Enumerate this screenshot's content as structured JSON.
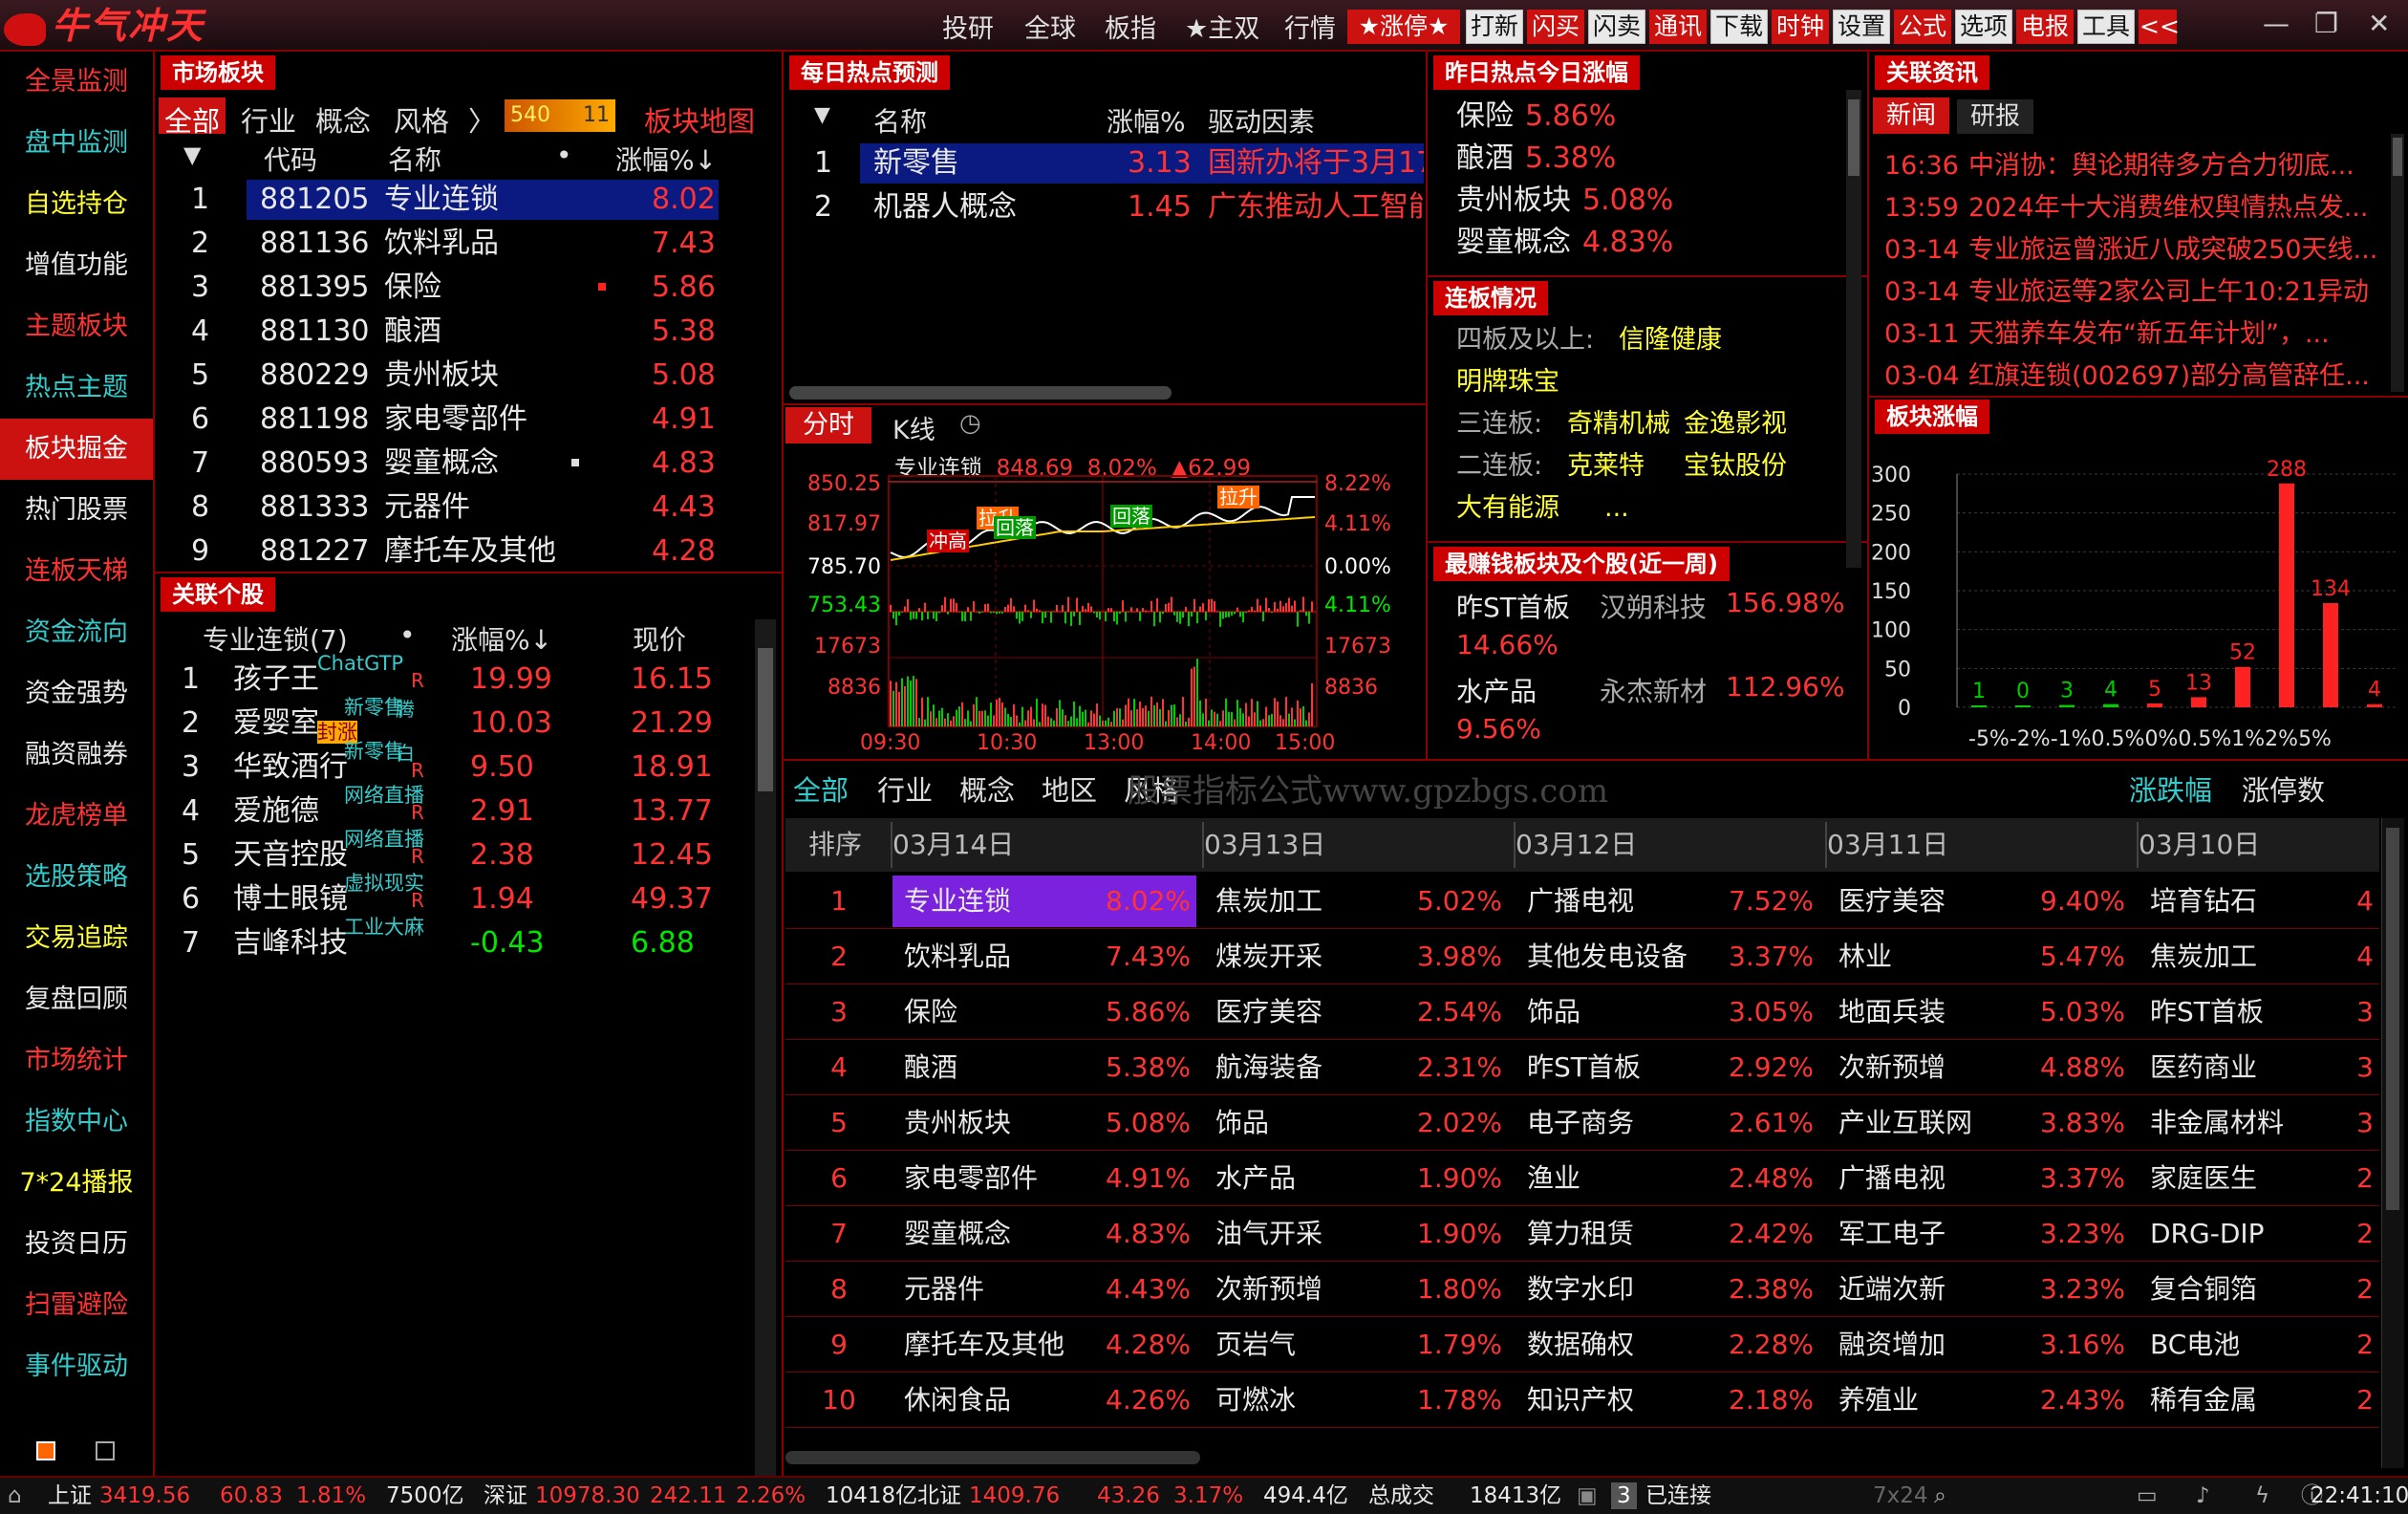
{
  "app": {
    "logo": "牛气冲天",
    "watermark": "股票指标公式www.gpzbgs.com"
  },
  "topnav": [
    "投研",
    "全球",
    "板指",
    "★主双",
    "行情"
  ],
  "topbuttons": [
    "★涨停★",
    "打新",
    "闪买",
    "闪卖",
    "通讯",
    "下载",
    "时钟",
    "设置",
    "公式",
    "选项",
    "电报",
    "工具",
    "<<"
  ],
  "sidebar": [
    "全景监测",
    "盘中监测",
    "自选持仓",
    "增值功能",
    "主题板块",
    "热点主题",
    "板块掘金",
    "热门股票",
    "连板天梯",
    "资金流向",
    "资金强势",
    "融资融券",
    "龙虎榜单",
    "选股策略",
    "交易追踪",
    "复盘回顾",
    "市场统计",
    "指数中心",
    "7*24播报",
    "投资日历",
    "扫雷避险",
    "事件驱动"
  ],
  "market_sector": {
    "title": "市场板块",
    "tabs": [
      "全部",
      "行业",
      "概念",
      "风格",
      "〉"
    ],
    "counter": "540",
    "counter2": "11",
    "map_link": "板块地图",
    "headers": [
      "代码",
      "名称",
      "•",
      "涨幅%↓"
    ],
    "rows": [
      {
        "n": "1",
        "code": "881205",
        "name": "专业连锁",
        "pct": "8.02"
      },
      {
        "n": "2",
        "code": "881136",
        "name": "饮料乳品",
        "pct": "7.43"
      },
      {
        "n": "3",
        "code": "881395",
        "name": "保险",
        "pct": "5.86"
      },
      {
        "n": "4",
        "code": "881130",
        "name": "酿酒",
        "pct": "5.38"
      },
      {
        "n": "5",
        "code": "880229",
        "name": "贵州板块",
        "pct": "5.08"
      },
      {
        "n": "6",
        "code": "881198",
        "name": "家电零部件",
        "pct": "4.91"
      },
      {
        "n": "7",
        "code": "880593",
        "name": "婴童概念",
        "pct": "4.83"
      },
      {
        "n": "8",
        "code": "881333",
        "name": "元器件",
        "pct": "4.43"
      },
      {
        "n": "9",
        "code": "881227",
        "name": "摩托车及其他",
        "pct": "4.28"
      }
    ]
  },
  "related_stocks": {
    "title": "关联个股",
    "headers": [
      "专业连锁(7)",
      "•",
      "涨幅%↓",
      "现价"
    ],
    "rows": [
      {
        "n": "1",
        "name": "孩子王",
        "tag": "ChatGTP",
        "flag": "R",
        "pct": "19.99",
        "price": "16.15"
      },
      {
        "n": "2",
        "name": "爱婴室",
        "tag": "新零售",
        "tag2": "封涨",
        "flag": "腾",
        "pct": "10.03",
        "price": "21.29"
      },
      {
        "n": "3",
        "name": "华致酒行",
        "tag": "新零售",
        "flag": "白",
        "flag2": "R",
        "pct": "9.50",
        "price": "18.91"
      },
      {
        "n": "4",
        "name": "爱施德",
        "tag": "网络直播",
        "flag": "R",
        "pct": "2.91",
        "price": "13.77"
      },
      {
        "n": "5",
        "name": "天音控股",
        "tag": "网络直播",
        "flag": "R",
        "pct": "2.38",
        "price": "12.45"
      },
      {
        "n": "6",
        "name": "博士眼镜",
        "tag": "虚拟现实",
        "flag": "R",
        "pct": "1.94",
        "price": "49.37"
      },
      {
        "n": "7",
        "name": "吉峰科技",
        "tag": "工业大麻",
        "flag": "",
        "pct": "-0.43",
        "price": "6.88"
      }
    ]
  },
  "daily_hot": {
    "title": "每日热点预测",
    "headers": [
      "名称",
      "涨幅%",
      "驱动因素"
    ],
    "rows": [
      {
        "n": "1",
        "name": "新零售",
        "pct": "3.13",
        "reason": "国新办将于3月17"
      },
      {
        "n": "2",
        "name": "机器人概念",
        "pct": "1.45",
        "reason": "广东推动人工智能"
      }
    ]
  },
  "yesterday_hot": {
    "title": "昨日热点今日涨幅",
    "rows": [
      {
        "name": "保险",
        "pct": "5.86%"
      },
      {
        "name": "酿酒",
        "pct": "5.38%"
      },
      {
        "name": "贵州板块",
        "pct": "5.08%"
      },
      {
        "name": "婴童概念",
        "pct": "4.83%"
      }
    ]
  },
  "limit_board": {
    "title": "连板情况",
    "rows": [
      {
        "label": "四板及以上:",
        "stocks": [
          "信隆健康"
        ]
      },
      {
        "label": "",
        "stocks": [
          "明牌珠宝"
        ]
      },
      {
        "label": "三连板:",
        "stocks": [
          "奇精机械",
          "金逸影视"
        ]
      },
      {
        "label": "二连板:",
        "stocks": [
          "克莱特",
          "宝钛股份"
        ]
      },
      {
        "label": "",
        "stocks": [
          "大有能源",
          "..."
        ]
      }
    ]
  },
  "most_profit": {
    "title": "最赚钱板块及个股(近一周)",
    "rows": [
      {
        "sector": "昨ST首板",
        "stock": "汉朔科技",
        "stock_pct": "156.98%",
        "sector_pct": "14.66%"
      },
      {
        "sector": "水产品",
        "stock": "永杰新材",
        "stock_pct": "112.96%",
        "sector_pct": "9.56%"
      }
    ]
  },
  "news": {
    "title": "关联资讯",
    "tabs": [
      "新闻",
      "研报"
    ],
    "rows": [
      {
        "time": "16:36",
        "text": "中消协：舆论期待多方合力彻底..."
      },
      {
        "time": "13:59",
        "text": "2024年十大消费维权舆情热点发..."
      },
      {
        "time": "03-14",
        "text": "专业旅运曾涨近八成突破250天线..."
      },
      {
        "time": "03-14",
        "text": "专业旅运等2家公司上午10:21异动"
      },
      {
        "time": "03-11",
        "text": "天猫养车发布“新五年计划”，..."
      },
      {
        "time": "03-04",
        "text": "红旗连锁(002697)部分高管辞任..."
      }
    ]
  },
  "intraday": {
    "tabs": [
      "分时",
      "K线"
    ],
    "name": "专业连锁",
    "price": "848.69",
    "pct": "8.02%",
    "change": "▲62.99",
    "y_left": [
      "850.25",
      "817.97",
      "785.70",
      "753.43",
      "17673",
      "8836"
    ],
    "y_right": [
      "8.22%",
      "4.11%",
      "0.00%",
      "4.11%",
      "17673",
      "8836"
    ],
    "x": [
      "09:30",
      "10:30",
      "13:00",
      "14:00",
      "15:00"
    ],
    "events": [
      "拉升",
      "冲高",
      "回落",
      "回落",
      "拉升"
    ]
  },
  "chart_data": {
    "type": "bar",
    "title": "板块涨幅",
    "categories": [
      "-5%",
      "-2%",
      "-1%",
      "0.5%",
      "0%",
      "0.5%",
      "1%",
      "2%",
      "5%"
    ],
    "values": [
      1,
      0,
      3,
      4,
      5,
      13,
      52,
      288,
      134,
      4
    ],
    "ylim": [
      0,
      300
    ],
    "yticks": [
      0,
      50,
      100,
      150,
      200,
      250,
      300
    ]
  },
  "bottom": {
    "tabs": [
      "全部",
      "行业",
      "概念",
      "地区",
      "风格"
    ],
    "right_tabs": [
      "涨跌幅",
      "涨停数"
    ],
    "rank_header": "排序",
    "dates": [
      "03月14日",
      "03月13日",
      "03月12日",
      "03月11日",
      "03月10日"
    ],
    "rows": [
      [
        [
          "专业连锁",
          "8.02%"
        ],
        [
          "焦炭加工",
          "5.02%"
        ],
        [
          "广播电视",
          "7.52%"
        ],
        [
          "医疗美容",
          "9.40%"
        ],
        [
          "培育钻石",
          "4"
        ]
      ],
      [
        [
          "饮料乳品",
          "7.43%"
        ],
        [
          "煤炭开采",
          "3.98%"
        ],
        [
          "其他发电设备",
          "3.37%"
        ],
        [
          "林业",
          "5.47%"
        ],
        [
          "焦炭加工",
          "4"
        ]
      ],
      [
        [
          "保险",
          "5.86%"
        ],
        [
          "医疗美容",
          "2.54%"
        ],
        [
          "饰品",
          "3.05%"
        ],
        [
          "地面兵装",
          "5.03%"
        ],
        [
          "昨ST首板",
          "3"
        ]
      ],
      [
        [
          "酿酒",
          "5.38%"
        ],
        [
          "航海装备",
          "2.31%"
        ],
        [
          "昨ST首板",
          "2.92%"
        ],
        [
          "次新预增",
          "4.88%"
        ],
        [
          "医药商业",
          "3"
        ]
      ],
      [
        [
          "贵州板块",
          "5.08%"
        ],
        [
          "饰品",
          "2.02%"
        ],
        [
          "电子商务",
          "2.61%"
        ],
        [
          "产业互联网",
          "3.83%"
        ],
        [
          "非金属材料",
          "3"
        ]
      ],
      [
        [
          "家电零部件",
          "4.91%"
        ],
        [
          "水产品",
          "1.90%"
        ],
        [
          "渔业",
          "2.48%"
        ],
        [
          "广播电视",
          "3.37%"
        ],
        [
          "家庭医生",
          "2"
        ]
      ],
      [
        [
          "婴童概念",
          "4.83%"
        ],
        [
          "油气开采",
          "1.90%"
        ],
        [
          "算力租赁",
          "2.42%"
        ],
        [
          "军工电子",
          "3.23%"
        ],
        [
          "DRG-DIP",
          "2"
        ]
      ],
      [
        [
          "元器件",
          "4.43%"
        ],
        [
          "次新预增",
          "1.80%"
        ],
        [
          "数字水印",
          "2.38%"
        ],
        [
          "近端次新",
          "3.23%"
        ],
        [
          "复合铜箔",
          "2"
        ]
      ],
      [
        [
          "摩托车及其他",
          "4.28%"
        ],
        [
          "页岩气",
          "1.79%"
        ],
        [
          "数据确权",
          "2.28%"
        ],
        [
          "融资增加",
          "3.16%"
        ],
        [
          "BC电池",
          "2"
        ]
      ],
      [
        [
          "休闲食品",
          "4.26%"
        ],
        [
          "可燃冰",
          "1.78%"
        ],
        [
          "知识产权",
          "2.18%"
        ],
        [
          "养殖业",
          "2.43%"
        ],
        [
          "稀有金属",
          "2"
        ]
      ]
    ]
  },
  "status": {
    "sh_label": "上证",
    "sh": "3419.56",
    "sh_chg": "60.83",
    "sh_pct": "1.81%",
    "sh_vol": "7500亿",
    "sz_label": "深证",
    "sz": "10978.30",
    "sz_chg": "242.11",
    "sz_pct": "2.26%",
    "sz_vol": "10418亿",
    "bz_label": "北证",
    "bz": "1409.76",
    "bz_chg": "43.26",
    "bz_pct": "3.17%",
    "bz_vol": "494.4亿",
    "total_label": "总成交",
    "total": "18413亿",
    "conn": "已连接",
    "badge": "3",
    "news247": "7x24",
    "clock": "22:41:10"
  }
}
